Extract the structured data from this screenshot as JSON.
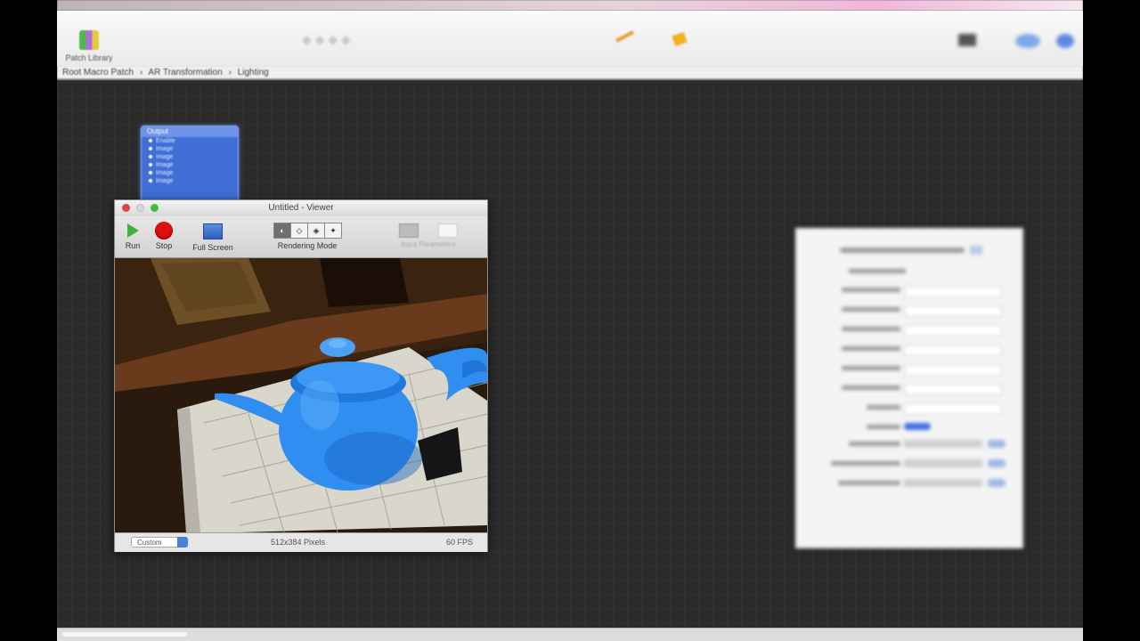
{
  "toolbar": {
    "library_label": "Patch Library"
  },
  "breadcrumb": [
    "Root Macro Patch",
    "AR Transformation",
    "Lighting"
  ],
  "patch_node": {
    "title": "Output",
    "ports": [
      "Enable",
      "Image",
      "Image",
      "Image",
      "Image",
      "Image"
    ]
  },
  "viewer": {
    "title": "Untitled - Viewer",
    "run_label": "Run",
    "stop_label": "Stop",
    "fullscreen_label": "Full Screen",
    "rendering_mode_label": "Rendering Mode",
    "input_params_label": "Input Parameters",
    "status_select": "Custom",
    "status_size": "512x384 Pixels",
    "status_fps": "60 FPS"
  },
  "colors": {
    "teapot": "#2f8ef0",
    "patch_blue": "#3f6fd6",
    "stop_red": "#e01010",
    "run_green": "#3cb43c"
  }
}
